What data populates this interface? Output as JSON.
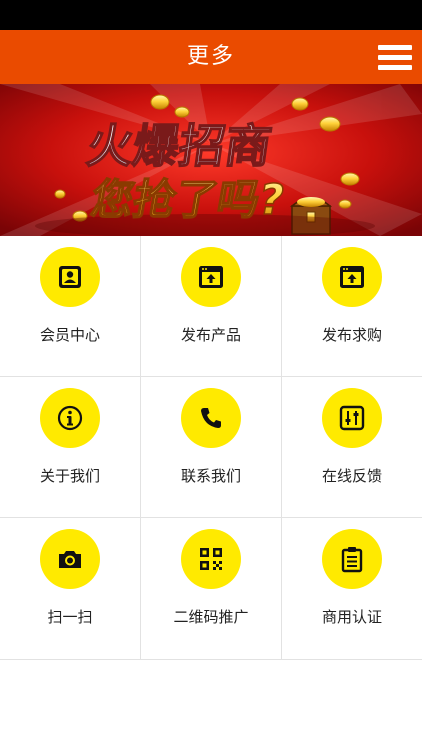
{
  "header": {
    "title": "更多",
    "menu_icon": "hamburger-menu-icon"
  },
  "banner": {
    "line1": "火爆招商",
    "line2": "您抢了吗?"
  },
  "grid": {
    "items": [
      {
        "label": "会员中心",
        "icon": "member-card-icon"
      },
      {
        "label": "发布产品",
        "icon": "upload-window-icon"
      },
      {
        "label": "发布求购",
        "icon": "upload-window-icon"
      },
      {
        "label": "关于我们",
        "icon": "info-icon"
      },
      {
        "label": "联系我们",
        "icon": "phone-icon"
      },
      {
        "label": "在线反馈",
        "icon": "sliders-icon"
      },
      {
        "label": "扫一扫",
        "icon": "camera-icon"
      },
      {
        "label": "二维码推广",
        "icon": "qr-code-icon"
      },
      {
        "label": "商用认证",
        "icon": "clipboard-icon"
      }
    ]
  },
  "colors": {
    "header": "#ea4b00",
    "icon_circle": "#ffea00",
    "icon_glyph": "#111111"
  }
}
